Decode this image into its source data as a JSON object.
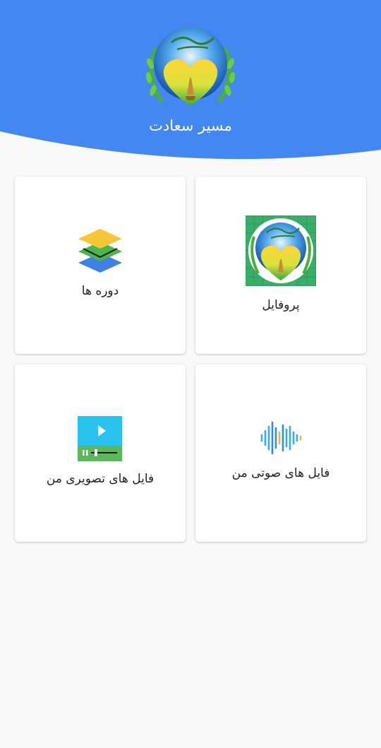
{
  "header": {
    "app_title": "مسیر سعادت",
    "background_color": "#4487f0",
    "logo_icon": "heart-prayer-logo-icon"
  },
  "grid": {
    "cards": [
      {
        "label": "پروفایل",
        "icon": "profile-logo-icon"
      },
      {
        "label": "دوره ها",
        "icon": "layers-icon"
      },
      {
        "label": "فایل های صوتی من",
        "icon": "sound-wave-icon"
      },
      {
        "label": "فایل های تصویری من",
        "icon": "video-player-icon"
      }
    ]
  }
}
